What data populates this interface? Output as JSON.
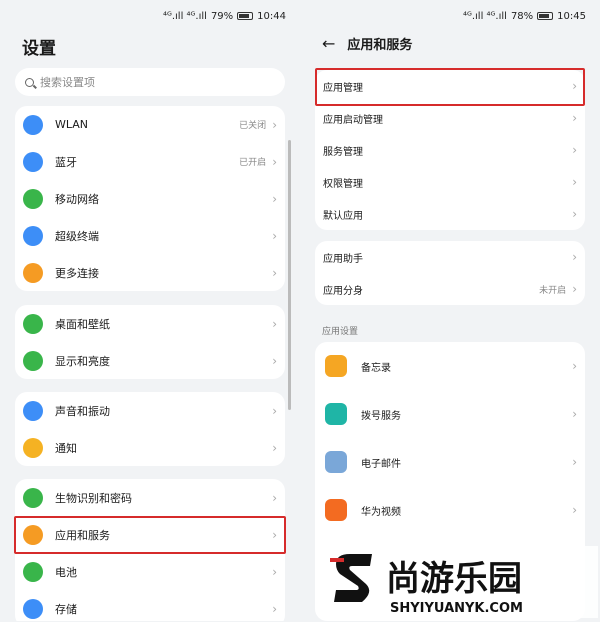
{
  "left": {
    "status": {
      "signal": "⁴ᴳ.ıll ⁴ᴳ.ıll",
      "battery": "79%",
      "time": "10:44"
    },
    "title": "设置",
    "search_placeholder": "搜索设置项",
    "groups": [
      [
        {
          "label": "WLAN",
          "value": "已关闭",
          "color": "#3d8ef7",
          "icon": "wifi-icon"
        },
        {
          "label": "蓝牙",
          "value": "已开启",
          "color": "#3d8ef7",
          "icon": "bluetooth-icon"
        },
        {
          "label": "移动网络",
          "value": "",
          "color": "#39b54a",
          "icon": "mobile-network-icon"
        },
        {
          "label": "超级终端",
          "value": "",
          "color": "#3d8ef7",
          "icon": "super-device-icon"
        },
        {
          "label": "更多连接",
          "value": "",
          "color": "#f59b23",
          "icon": "link-icon"
        }
      ],
      [
        {
          "label": "桌面和壁纸",
          "value": "",
          "color": "#39b54a",
          "icon": "wallpaper-icon"
        },
        {
          "label": "显示和亮度",
          "value": "",
          "color": "#39b54a",
          "icon": "display-icon"
        }
      ],
      [
        {
          "label": "声音和振动",
          "value": "",
          "color": "#3d8ef7",
          "icon": "sound-icon"
        },
        {
          "label": "通知",
          "value": "",
          "color": "#f5b223",
          "icon": "bell-icon"
        }
      ],
      [
        {
          "label": "生物识别和密码",
          "value": "",
          "color": "#39b54a",
          "icon": "key-icon"
        },
        {
          "label": "应用和服务",
          "value": "",
          "color": "#f59b23",
          "icon": "apps-icon"
        },
        {
          "label": "电池",
          "value": "",
          "color": "#39b54a",
          "icon": "battery-icon"
        },
        {
          "label": "存储",
          "value": "",
          "color": "#3d8ef7",
          "icon": "storage-icon"
        }
      ]
    ]
  },
  "right": {
    "status": {
      "signal": "⁴ᴳ.ıll ⁴ᴳ.ıll",
      "battery": "78%",
      "time": "10:45"
    },
    "title": "应用和服务",
    "group1": [
      "应用管理",
      "应用启动管理",
      "服务管理",
      "权限管理",
      "默认应用"
    ],
    "group2": [
      {
        "label": "应用助手",
        "value": ""
      },
      {
        "label": "应用分身",
        "value": "未开启"
      }
    ],
    "section": "应用设置",
    "apps": [
      {
        "label": "备忘录",
        "color": "#f5a623",
        "icon": "memo-icon"
      },
      {
        "label": "拨号服务",
        "color": "#1fb5a6",
        "icon": "phone-icon"
      },
      {
        "label": "电子邮件",
        "color": "#7aa7d8",
        "icon": "mail-icon"
      },
      {
        "label": "华为视频",
        "color": "#f36b21",
        "icon": "video-icon"
      }
    ]
  },
  "watermark": {
    "brand": "尚游乐园",
    "url": "SHYIYUANYK.COM"
  }
}
